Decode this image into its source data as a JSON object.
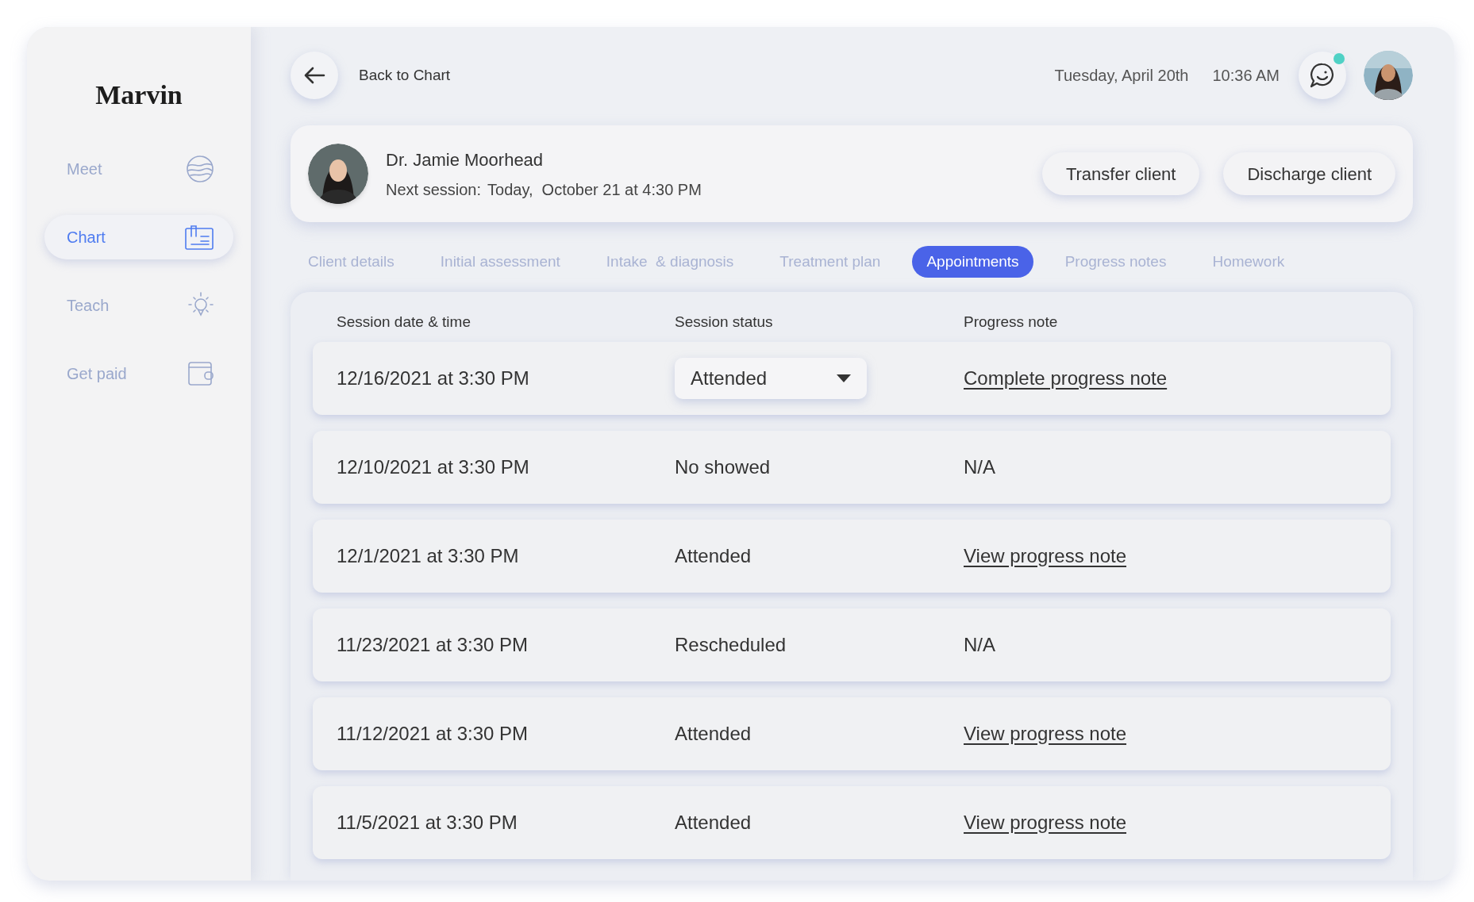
{
  "brand": "Marvin",
  "sidebar": {
    "items": [
      {
        "label": "Meet",
        "selected": false
      },
      {
        "label": "Chart",
        "selected": true
      },
      {
        "label": "Teach",
        "selected": false
      },
      {
        "label": "Get paid",
        "selected": false
      }
    ]
  },
  "topbar": {
    "back": "Back to Chart",
    "date": "Tuesday, April 20th",
    "time": "10:36 AM",
    "chat_unread": true
  },
  "client": {
    "name": "Dr. Jamie Moorhead",
    "next_label": "Next session:",
    "next_value": "Today,  October 21 at 4:30 PM",
    "buttons": [
      "Transfer client",
      "Discharge client"
    ]
  },
  "tabs": [
    {
      "label": "Client details",
      "selected": false
    },
    {
      "label": "Initial assessment",
      "selected": false
    },
    {
      "label": "Intake  & diagnosis",
      "selected": false
    },
    {
      "label": "Treatment plan",
      "selected": false
    },
    {
      "label": "Appointments",
      "selected": true
    },
    {
      "label": "Progress notes",
      "selected": false
    },
    {
      "label": "Homework",
      "selected": false
    }
  ],
  "table": {
    "columns": [
      "Session date & time",
      "Session status",
      "Progress note"
    ],
    "rows": [
      {
        "date": "12/16/2021 at 3:30 PM",
        "status": {
          "kind": "dropdown",
          "text": "Attended"
        },
        "note": {
          "kind": "link",
          "text": "Complete progress note"
        }
      },
      {
        "date": "12/10/2021 at 3:30 PM",
        "status": {
          "kind": "text",
          "text": "No showed"
        },
        "note": {
          "kind": "text",
          "text": "N/A"
        }
      },
      {
        "date": "12/1/2021 at 3:30 PM",
        "status": {
          "kind": "text",
          "text": "Attended"
        },
        "note": {
          "kind": "link",
          "text": "View progress note"
        }
      },
      {
        "date": "11/23/2021 at 3:30 PM",
        "status": {
          "kind": "text",
          "text": "Rescheduled"
        },
        "note": {
          "kind": "text",
          "text": "N/A"
        }
      },
      {
        "date": "11/12/2021 at 3:30 PM",
        "status": {
          "kind": "text",
          "text": "Attended"
        },
        "note": {
          "kind": "link",
          "text": "View progress note"
        }
      },
      {
        "date": "11/5/2021 at 3:30 PM",
        "status": {
          "kind": "text",
          "text": "Attended"
        },
        "note": {
          "kind": "link",
          "text": "View progress note"
        }
      }
    ]
  }
}
